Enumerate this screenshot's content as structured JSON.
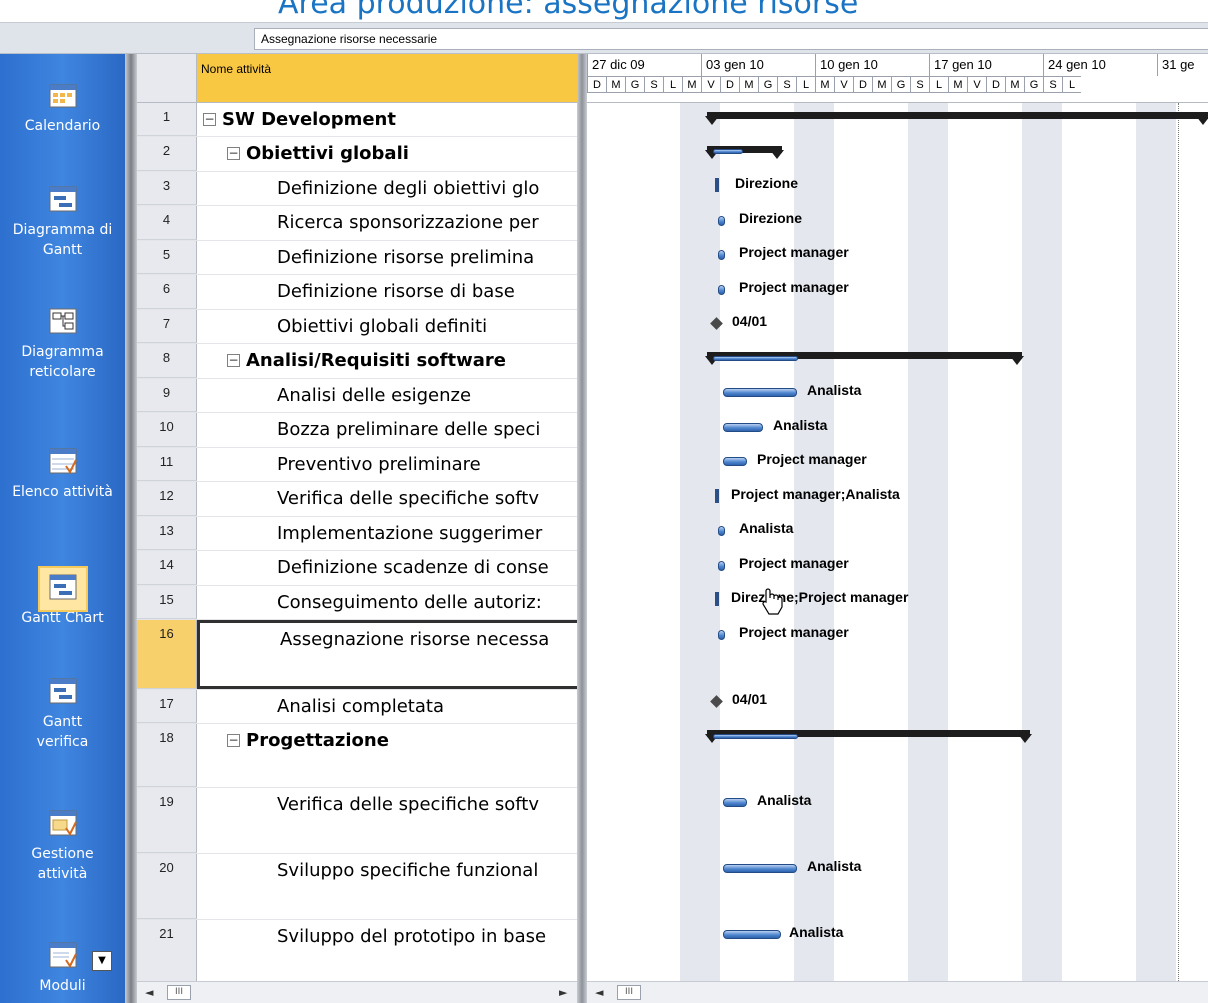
{
  "banner": {
    "title": "Area produzione: assegnazione risorse"
  },
  "entry_bar": {
    "value": "Assegnazione risorse necessarie"
  },
  "viewbar": {
    "items": [
      {
        "label": "Calendario",
        "icon": "calendar-icon"
      },
      {
        "label": "Diagramma di Gantt",
        "icon": "gantt-icon"
      },
      {
        "label": "Diagramma reticolare",
        "icon": "network-diagram-icon"
      },
      {
        "label": "Elenco attività",
        "icon": "task-list-icon"
      },
      {
        "label": "Gantt Chart",
        "icon": "gantt-chart-icon",
        "selected": true
      },
      {
        "label": "Gantt verifica",
        "icon": "tracking-gantt-icon"
      },
      {
        "label": "Gestione attività",
        "icon": "task-usage-icon"
      },
      {
        "label": "Moduli",
        "icon": "forms-icon"
      }
    ]
  },
  "table": {
    "header_name": "Nome attività",
    "rows": [
      {
        "id": "1",
        "name": "SW Development",
        "summary": true,
        "indent": 0
      },
      {
        "id": "2",
        "name": "Obiettivi globali",
        "summary": true,
        "indent": 1
      },
      {
        "id": "3",
        "name": "Definizione degli obiettivi glo",
        "indent": 2
      },
      {
        "id": "4",
        "name": "Ricerca sponsorizzazione per",
        "indent": 2
      },
      {
        "id": "5",
        "name": "Definizione risorse prelimina",
        "indent": 2
      },
      {
        "id": "6",
        "name": "Definizione risorse di base",
        "indent": 2
      },
      {
        "id": "7",
        "name": "Obiettivi globali definiti",
        "indent": 2
      },
      {
        "id": "8",
        "name": "Analisi/Requisiti software",
        "summary": true,
        "indent": 1
      },
      {
        "id": "9",
        "name": "Analisi delle esigenze",
        "indent": 2
      },
      {
        "id": "10",
        "name": "Bozza preliminare delle speci",
        "indent": 2
      },
      {
        "id": "11",
        "name": "Preventivo preliminare",
        "indent": 2
      },
      {
        "id": "12",
        "name": "Verifica delle specifiche softv",
        "indent": 2
      },
      {
        "id": "13",
        "name": "Implementazione suggerimer",
        "indent": 2
      },
      {
        "id": "14",
        "name": "Definizione scadenze di conse",
        "indent": 2
      },
      {
        "id": "15",
        "name": "Conseguimento delle autoriz:",
        "indent": 2
      },
      {
        "id": "16",
        "name": "Assegnazione risorse necessa",
        "indent": 2,
        "selected": true
      },
      {
        "id": "17",
        "name": "Analisi completata",
        "indent": 2
      },
      {
        "id": "18",
        "name": "Progettazione",
        "summary": true,
        "indent": 1
      },
      {
        "id": "19",
        "name": "Verifica delle specifiche softv",
        "indent": 2
      },
      {
        "id": "20",
        "name": "Sviluppo specifiche funzional",
        "indent": 2
      },
      {
        "id": "21",
        "name": "Sviluppo del prototipo in base",
        "indent": 2
      }
    ]
  },
  "timescale": {
    "weeks": [
      "27 dic 09",
      "03 gen 10",
      "10 gen 10",
      "17 gen 10",
      "24 gen 10",
      "31 ge"
    ],
    "days": [
      "D",
      "M",
      "G",
      "S",
      "L",
      "M",
      "V",
      "D",
      "M",
      "G",
      "S",
      "L",
      "M",
      "V",
      "D",
      "M",
      "G",
      "S",
      "L",
      "M",
      "V",
      "D",
      "M",
      "G",
      "S",
      "L"
    ]
  },
  "gantt_labels": {
    "r3": "Direzione",
    "r4": "Direzione",
    "r5": "Project manager",
    "r6": "Project manager",
    "r7": "04/01",
    "r9": "Analista",
    "r10": "Analista",
    "r11": "Project manager",
    "r12": "Project manager;Analista",
    "r13": "Analista",
    "r14": "Project manager",
    "r15": "Direzione;Project manager",
    "r16": "Project manager",
    "r17": "04/01",
    "r19": "Analista",
    "r20": "Analista",
    "r21": "Analista"
  },
  "scroll": {
    "left_arrow": "◄",
    "right_arrow": "►",
    "thumb": "III"
  }
}
